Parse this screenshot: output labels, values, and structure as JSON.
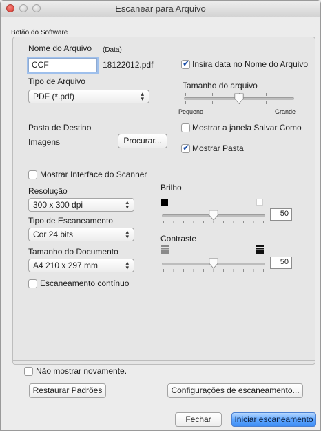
{
  "window": {
    "title": "Escanear para Arquivo"
  },
  "software_group": {
    "label": "Botão do Software"
  },
  "file_name": {
    "label": "Nome do Arquivo",
    "data_tag": "(Data)",
    "value": "CCF",
    "suffix": "18122012.pdf"
  },
  "insert_date": {
    "label": "Insira data no Nome do Arquivo",
    "checked": true
  },
  "file_type": {
    "label": "Tipo de Arquivo",
    "selected": "PDF (*.pdf)"
  },
  "file_size": {
    "label": "Tamanho do arquivo",
    "min_label": "Pequeno",
    "max_label": "Grande",
    "level": 0.5
  },
  "destination": {
    "label": "Pasta de Destino",
    "folder": "Imagens",
    "browse_label": "Procurar..."
  },
  "show_save_as": {
    "label": "Mostrar a janela Salvar Como",
    "checked": false
  },
  "show_folder": {
    "label": "Mostrar Pasta",
    "checked": true
  },
  "scanner_interface": {
    "label": "Mostrar Interface do Scanner",
    "checked": false
  },
  "resolution": {
    "label": "Resolução",
    "selected": "300 x 300 dpi"
  },
  "scan_type": {
    "label": "Tipo de Escaneamento",
    "selected": "Cor 24 bits"
  },
  "document_size": {
    "label": "Tamanho do Documento",
    "selected": "A4 210 x 297 mm"
  },
  "continuous": {
    "label": "Escaneamento contínuo",
    "checked": false
  },
  "brightness": {
    "label": "Brilho",
    "value": "50"
  },
  "contrast": {
    "label": "Contraste",
    "value": "50"
  },
  "dont_show": {
    "label": "Não mostrar novamente.",
    "checked": false
  },
  "buttons": {
    "restore": "Restaurar Padrões",
    "scan_settings": "Configurações de escaneamento...",
    "close": "Fechar",
    "start": "Iniciar escaneamento"
  },
  "icons": {
    "close": "close-window-icon",
    "minimize": "minimize-window-icon",
    "zoom": "zoom-window-icon",
    "popup_arrows": "up-down-arrows-icon",
    "checkmark": "checkmark-icon",
    "brightness_low": "black-square-icon",
    "brightness_high": "white-square-icon",
    "contrast_low": "low-contrast-lines-icon",
    "contrast_high": "high-contrast-lines-icon"
  }
}
